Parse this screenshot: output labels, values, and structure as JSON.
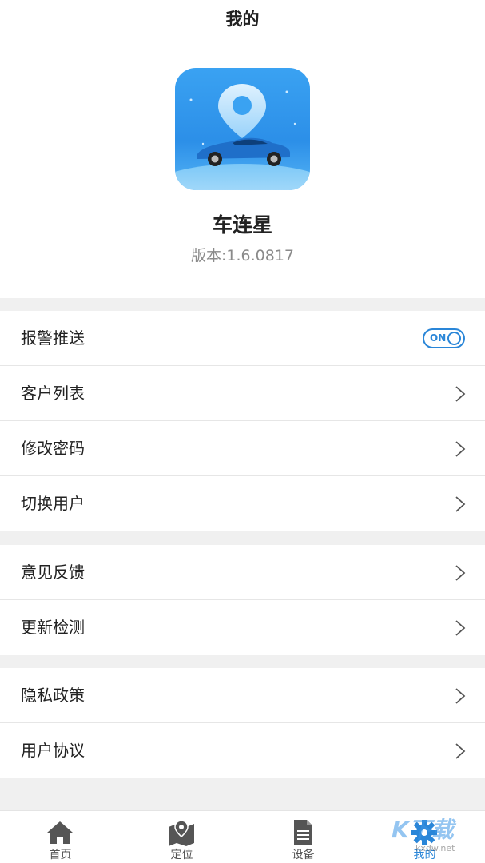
{
  "header": {
    "title": "我的"
  },
  "profile": {
    "app_name": "车连星",
    "version": "版本:1.6.0817"
  },
  "groups": [
    {
      "items": [
        {
          "label": "报警推送",
          "control": "toggle",
          "toggle_text": "ON",
          "toggle_on": true
        },
        {
          "label": "客户列表",
          "control": "chevron"
        },
        {
          "label": "修改密码",
          "control": "chevron"
        },
        {
          "label": "切换用户",
          "control": "chevron"
        }
      ]
    },
    {
      "items": [
        {
          "label": "意见反馈",
          "control": "chevron"
        },
        {
          "label": "更新检测",
          "control": "chevron"
        }
      ]
    },
    {
      "items": [
        {
          "label": "隐私政策",
          "control": "chevron"
        },
        {
          "label": "用户协议",
          "control": "chevron"
        }
      ]
    }
  ],
  "tabbar": {
    "tabs": [
      {
        "label": "首页",
        "icon": "home-icon"
      },
      {
        "label": "定位",
        "icon": "map-icon"
      },
      {
        "label": "设备",
        "icon": "document-icon"
      },
      {
        "label": "我的",
        "icon": "gear-icon",
        "active": true
      }
    ]
  },
  "watermark": {
    "text": "K下载",
    "sub": "kxdw.net"
  },
  "colors": {
    "accent": "#2a86d8",
    "background": "#f0f0f0"
  }
}
